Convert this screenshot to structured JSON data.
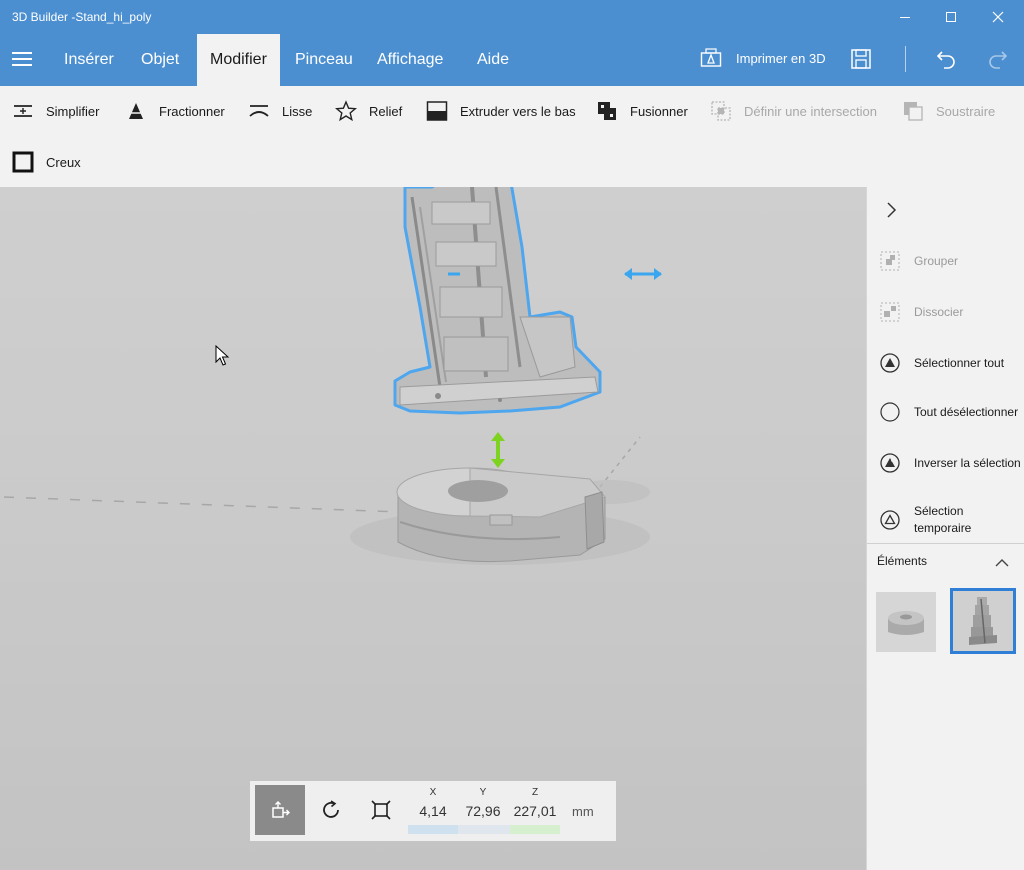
{
  "window": {
    "title": "3D Builder -Stand_hi_poly"
  },
  "tabs": [
    {
      "label": "Insérer"
    },
    {
      "label": "Objet"
    },
    {
      "label": "Modifier"
    },
    {
      "label": "Pinceau"
    },
    {
      "label": "Affichage"
    },
    {
      "label": "Aide"
    }
  ],
  "active_tab": "Modifier",
  "header_actions": {
    "print_label": "Imprimer en 3D"
  },
  "ribbon": {
    "tools": [
      {
        "label": "Simplifier",
        "icon": "simplify-icon",
        "enabled": true
      },
      {
        "label": "Fractionner",
        "icon": "split-icon",
        "enabled": true
      },
      {
        "label": "Lisse",
        "icon": "smooth-icon",
        "enabled": true
      },
      {
        "label": "Relief",
        "icon": "emboss-icon",
        "enabled": true
      },
      {
        "label": "Extruder vers le bas",
        "icon": "extrude-down-icon",
        "enabled": true
      },
      {
        "label": "Fusionner",
        "icon": "merge-icon",
        "enabled": true
      },
      {
        "label": "Définir une intersection",
        "icon": "intersect-icon",
        "enabled": false
      },
      {
        "label": "Soustraire",
        "icon": "subtract-icon",
        "enabled": false
      },
      {
        "label": "Creux",
        "icon": "hollow-icon",
        "enabled": true
      }
    ]
  },
  "right_panel": {
    "actions": [
      {
        "label": "Grouper",
        "icon": "group-icon",
        "enabled": false
      },
      {
        "label": "Dissocier",
        "icon": "ungroup-icon",
        "enabled": false
      },
      {
        "label": "Sélectionner tout",
        "icon": "select-all-icon",
        "enabled": true
      },
      {
        "label": "Tout désélectionner",
        "icon": "deselect-all-icon",
        "enabled": true
      },
      {
        "label": "Inverser la sélection",
        "icon": "invert-selection-icon",
        "enabled": true
      },
      {
        "label": "Sélection temporaire",
        "icon": "temporary-selection-icon",
        "enabled": true
      }
    ],
    "elements_title": "Éléments"
  },
  "transform": {
    "x_label": "X",
    "y_label": "Y",
    "z_label": "Z",
    "x": "4,14",
    "y": "72,96",
    "z": "227,01",
    "unit": "mm"
  },
  "colors": {
    "accent": "#4c8fd1",
    "selection": "#2f7fd6",
    "move_handle_horizontal": "#3aa6f0",
    "move_handle_vertical": "#7ed321"
  }
}
